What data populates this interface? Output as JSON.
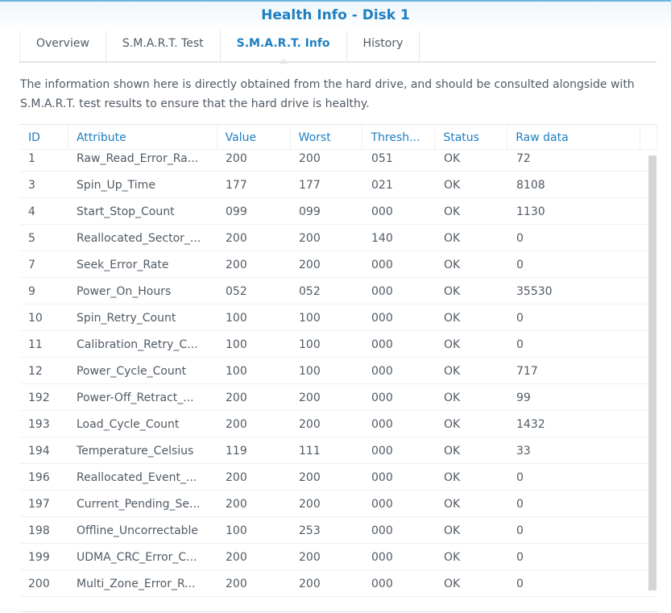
{
  "title": "Health Info - Disk 1",
  "tabs": [
    "Overview",
    "S.M.A.R.T. Test",
    "S.M.A.R.T. Info",
    "History"
  ],
  "description": "The information shown here is directly obtained from the hard drive, and should be consulted alongside with S.M.A.R.T. test results to ensure that the hard drive is healthy.",
  "columns": [
    "ID",
    "Attribute",
    "Value",
    "Worst",
    "Thresh...",
    "Status",
    "Raw data"
  ],
  "rows": [
    [
      "1",
      "Raw_Read_Error_Ra...",
      "200",
      "200",
      "051",
      "OK",
      "72"
    ],
    [
      "3",
      "Spin_Up_Time",
      "177",
      "177",
      "021",
      "OK",
      "8108"
    ],
    [
      "4",
      "Start_Stop_Count",
      "099",
      "099",
      "000",
      "OK",
      "1130"
    ],
    [
      "5",
      "Reallocated_Sector_...",
      "200",
      "200",
      "140",
      "OK",
      "0"
    ],
    [
      "7",
      "Seek_Error_Rate",
      "200",
      "200",
      "000",
      "OK",
      "0"
    ],
    [
      "9",
      "Power_On_Hours",
      "052",
      "052",
      "000",
      "OK",
      "35530"
    ],
    [
      "10",
      "Spin_Retry_Count",
      "100",
      "100",
      "000",
      "OK",
      "0"
    ],
    [
      "11",
      "Calibration_Retry_C...",
      "100",
      "100",
      "000",
      "OK",
      "0"
    ],
    [
      "12",
      "Power_Cycle_Count",
      "100",
      "100",
      "000",
      "OK",
      "717"
    ],
    [
      "192",
      "Power-Off_Retract_...",
      "200",
      "200",
      "000",
      "OK",
      "99"
    ],
    [
      "193",
      "Load_Cycle_Count",
      "200",
      "200",
      "000",
      "OK",
      "1432"
    ],
    [
      "194",
      "Temperature_Celsius",
      "119",
      "111",
      "000",
      "OK",
      "33"
    ],
    [
      "196",
      "Reallocated_Event_...",
      "200",
      "200",
      "000",
      "OK",
      "0"
    ],
    [
      "197",
      "Current_Pending_Se...",
      "200",
      "200",
      "000",
      "OK",
      "0"
    ],
    [
      "198",
      "Offline_Uncorrectable",
      "100",
      "253",
      "000",
      "OK",
      "0"
    ],
    [
      "199",
      "UDMA_CRC_Error_C...",
      "200",
      "200",
      "000",
      "OK",
      "0"
    ],
    [
      "200",
      "Multi_Zone_Error_R...",
      "200",
      "200",
      "000",
      "OK",
      "0"
    ]
  ]
}
